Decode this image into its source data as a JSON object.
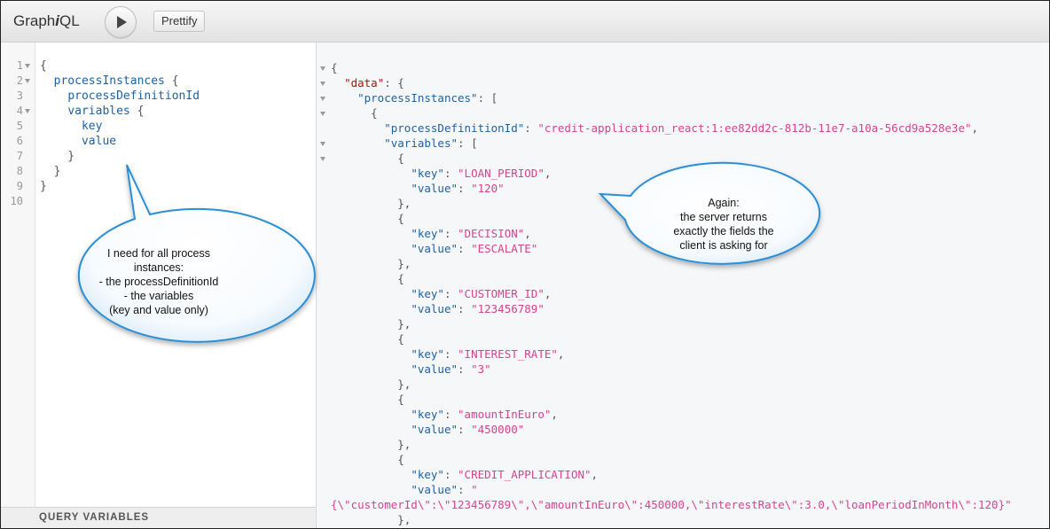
{
  "app": {
    "logo_prefix": "Graph",
    "logo_i": "i",
    "logo_suffix": "QL",
    "prettify_label": "Prettify",
    "run_icon": "play-icon"
  },
  "query_editor": {
    "line_numbers": [
      "1",
      "2",
      "3",
      "4",
      "5",
      "6",
      "7",
      "8",
      "9",
      "10"
    ],
    "lines": [
      "{",
      "  processInstances {",
      "    processDefinitionId",
      "    variables {",
      "      key",
      "      value",
      "    }",
      "  }",
      "}",
      ""
    ],
    "footer_label": "QUERY VARIABLES"
  },
  "result": {
    "lines": [
      "{",
      "  \"data\": {",
      "    \"processInstances\": [",
      "      {",
      "        \"processDefinitionId\": \"credit-application_react:1:ee82dd2c-812b-11e7-a10a-56cd9a528e3e\",",
      "        \"variables\": [",
      "          {",
      "            \"key\": \"LOAN_PERIOD\",",
      "            \"value\": \"120\"",
      "          },",
      "          {",
      "            \"key\": \"DECISION\",",
      "            \"value\": \"ESCALATE\"",
      "          },",
      "          {",
      "            \"key\": \"CUSTOMER_ID\",",
      "            \"value\": \"123456789\"",
      "          },",
      "          {",
      "            \"key\": \"INTEREST_RATE\",",
      "            \"value\": \"3\"",
      "          },",
      "          {",
      "            \"key\": \"amountInEuro\",",
      "            \"value\": \"450000\"",
      "          },",
      "          {",
      "            \"key\": \"CREDIT_APPLICATION\",",
      "            \"value\": \"",
      "{\\\"customerId\\\":\\\"123456789\\\",\\\"amountInEuro\\\":450000,\\\"interestRate\\\":3.0,\\\"loanPeriodInMonth\\\":120}\"",
      "          },"
    ]
  },
  "callouts": {
    "left": "I need for all process\ninstances:\n- the processDefinitionId\n- the variables\n(key and value only)",
    "right": "Again:\nthe server returns\nexactly the fields the\nclient is asking for"
  },
  "colors": {
    "field": "#1f61a0",
    "string": "#d64292",
    "data_key": "#aa1111",
    "bubble_stroke": "#2a8fd6"
  }
}
